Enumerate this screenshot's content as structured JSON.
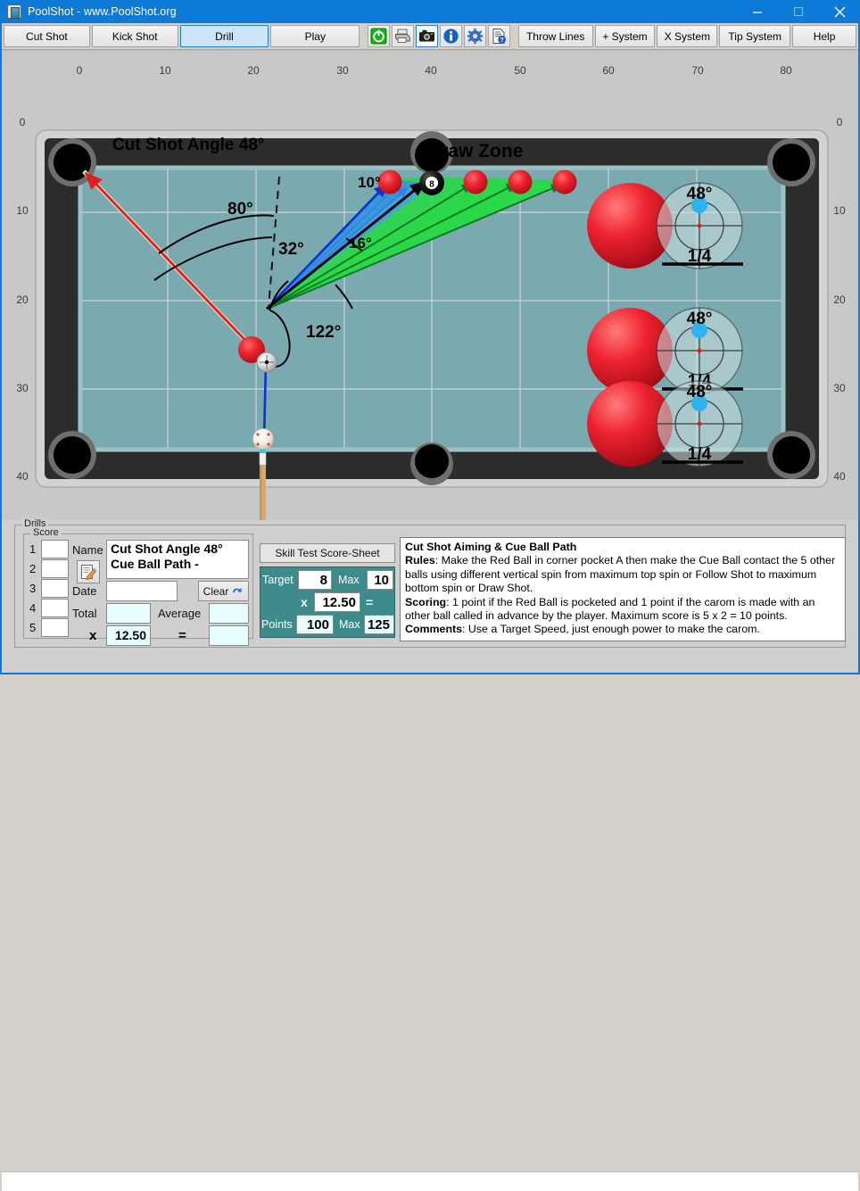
{
  "window": {
    "title": "PoolShot - www.PoolShot.org",
    "icon": "app-icon",
    "minimize": "minimize-icon",
    "maximize": "maximize-icon",
    "close": "close-icon"
  },
  "toolbar": {
    "tabs": [
      {
        "label": "Cut Shot",
        "selected": false
      },
      {
        "label": "Kick Shot",
        "selected": false
      },
      {
        "label": "Drill",
        "selected": true
      },
      {
        "label": "Play",
        "selected": false
      }
    ],
    "icons": [
      {
        "name": "power-icon",
        "framed": false
      },
      {
        "name": "printer-icon",
        "framed": false
      },
      {
        "name": "camera-icon",
        "framed": true
      },
      {
        "name": "info-icon",
        "framed": false
      },
      {
        "name": "gear-icon",
        "framed": false
      },
      {
        "name": "document-help-icon",
        "framed": false
      }
    ],
    "buttons": [
      {
        "label": "Throw Lines"
      },
      {
        "label": "+ System"
      },
      {
        "label": "X System"
      },
      {
        "label": "Tip System"
      },
      {
        "label": "Help"
      }
    ]
  },
  "table": {
    "ruler_top": [
      "0",
      "10",
      "20",
      "30",
      "40",
      "50",
      "60",
      "70",
      "80"
    ],
    "ruler_left": [
      "0",
      "10",
      "20",
      "30",
      "40"
    ],
    "ruler_right": [
      "0",
      "10",
      "20",
      "30",
      "40"
    ],
    "felt_color": "#7aaab0",
    "rail_color": "#2a2a2a",
    "annotations": [
      {
        "name": "cut-shot-angle-label",
        "text": "Cut Shot Angle 48°"
      },
      {
        "name": "angle-80-label",
        "text": "80°"
      },
      {
        "name": "angle-32-label",
        "text": "32°"
      },
      {
        "name": "angle-122-label",
        "text": "122°"
      },
      {
        "name": "angle-10-label",
        "text": "10°"
      },
      {
        "name": "angle-16-label",
        "text": "16°"
      },
      {
        "name": "draw-zone-label",
        "text": "Draw Zone"
      }
    ],
    "eight_ball_number": "8",
    "aim_diagrams": [
      {
        "angle": "48°",
        "fraction": "1/4"
      },
      {
        "angle": "48°",
        "fraction": "1/4"
      },
      {
        "angle": "48°",
        "fraction": "1/4"
      }
    ]
  },
  "drills": {
    "group_label": "Drills",
    "score_group_label": "Score",
    "rows": [
      "1",
      "2",
      "3",
      "4",
      "5"
    ],
    "score_values": [
      "",
      "",
      "",
      "",
      ""
    ],
    "name_label": "Name",
    "name_value": "Cut Shot Angle 48°\nCue Ball Path -",
    "name_line1": "Cut Shot Angle 48°",
    "name_line2": "Cue Ball Path -",
    "edit_icon": "edit-note-icon",
    "date_label": "Date",
    "date_value": "",
    "clear_label": "Clear",
    "clear_icon": "undo-icon",
    "total_label": "Total",
    "total_value": "",
    "average_label": "Average",
    "average_value": "",
    "multiply_label": "x",
    "multiplier_value": "12.50",
    "equals_label": "=",
    "result_value": ""
  },
  "skill_test": {
    "header": "Skill Test Score-Sheet",
    "target_label": "Target",
    "target_value": "8",
    "target_max_label": "Max",
    "target_max_value": "10",
    "multiply_label": "x",
    "multiplier_value": "12.50",
    "equals_label": "=",
    "points_label": "Points",
    "points_value": "100",
    "points_max_label": "Max",
    "points_max_value": "125"
  },
  "description": {
    "title": "Cut Shot Aiming & Cue Ball Path",
    "rules_label": "Rules",
    "rules_text": ": Make the Red Ball in corner pocket A then make the Cue Ball contact the 5 other balls using different vertical spin from maximum top spin or Follow Shot to maximum bottom spin or Draw Shot.",
    "scoring_label": "Scoring",
    "scoring_text": ": 1 point if the Red Ball is pocketed and 1 point if the carom is made with an other ball called in advance by the player. Maximum score is 5 x 2 = 10 points.",
    "comments_label": "Comments",
    "comments_text": ": Use a Target Speed, just enough power to make the carom."
  }
}
